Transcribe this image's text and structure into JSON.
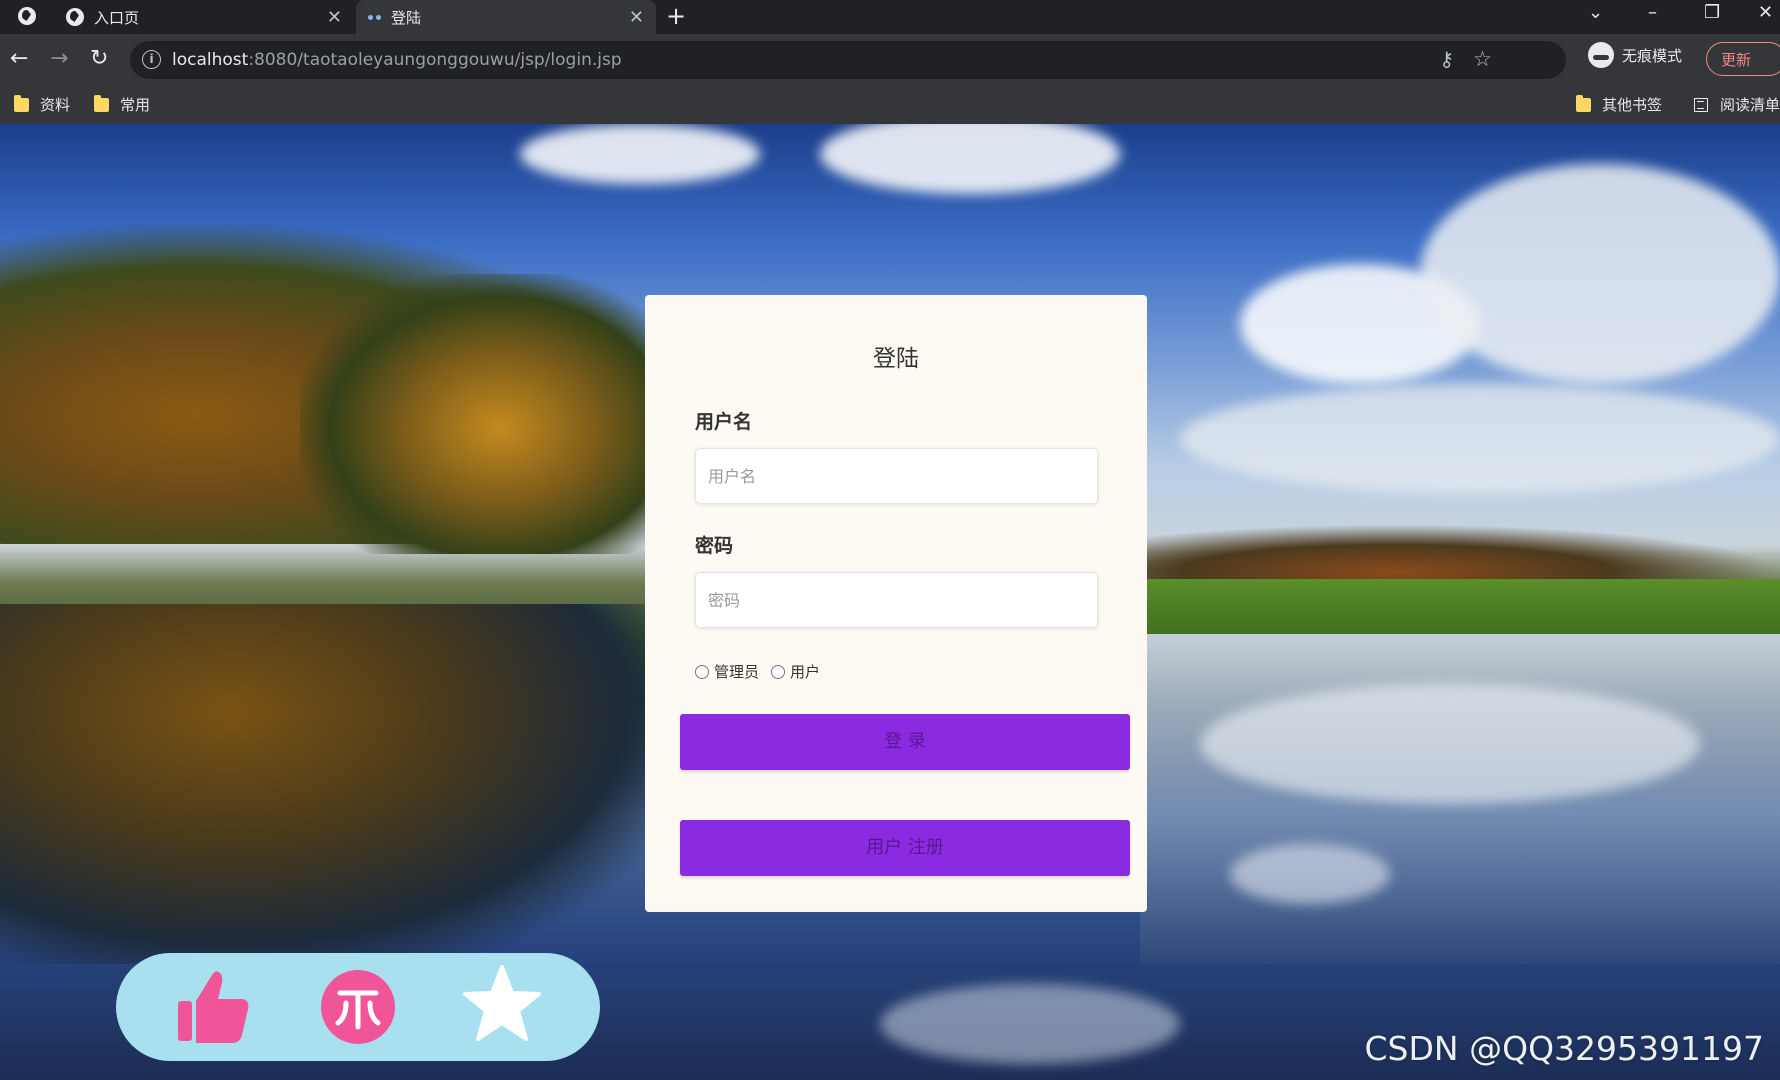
{
  "browser": {
    "tabs": [
      {
        "title": "入口页",
        "active": false
      },
      {
        "title": "登陆",
        "active": true
      }
    ],
    "new_tab_symbol": "+",
    "url_host": "localhost",
    "url_rest": ":8080/taotaoleyaungonggouwu/jsp/login.jsp",
    "incognito_label": "无痕模式",
    "update_label": "更新",
    "bookmarks": [
      {
        "label": "资料",
        "icon": "folder-icon"
      },
      {
        "label": "常用",
        "icon": "folder-icon"
      }
    ],
    "bookmarks_right": [
      {
        "label": "其他书签",
        "icon": "folder-icon"
      },
      {
        "label": "阅读清单",
        "icon": "reading-list-icon"
      }
    ]
  },
  "login": {
    "title": "登陆",
    "username_label": "用户名",
    "username_placeholder": "用户名",
    "password_label": "密码",
    "password_placeholder": "密码",
    "role_options": [
      "管理员",
      "用户"
    ],
    "login_button": "登 录",
    "register_button": "用户 注册"
  },
  "action_bar": {
    "icons": [
      "thumbs-up-icon",
      "coin-icon",
      "star-icon"
    ],
    "background": "#a9e0ef",
    "icon_color": "#f0559a"
  },
  "watermark": "CSDN @QQ3295391197",
  "colors": {
    "button_purple": "#8a2be2",
    "card_background": "#fdfaf3"
  }
}
